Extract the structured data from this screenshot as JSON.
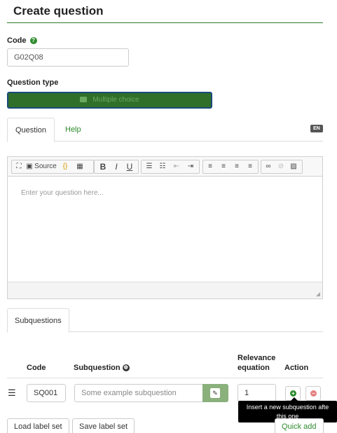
{
  "page": {
    "title": "Create question"
  },
  "code": {
    "label": "Code",
    "value": "G02Q08"
  },
  "question_type": {
    "label": "Question type",
    "selected": "Multiple choice",
    "icon": "list-icon"
  },
  "tabs": {
    "question": "Question",
    "help": "Help",
    "language": "EN"
  },
  "editor": {
    "toolbar": {
      "maximize": "⛶",
      "source": "Source",
      "bold": "B",
      "italic": "I",
      "underline": "U"
    },
    "placeholder": "Enter your question here..."
  },
  "subquestions": {
    "tab": "Subquestions",
    "headers": {
      "code": "Code",
      "subquestion": "Subquestion",
      "relevance_line1": "Relevance",
      "relevance_line2": "equation",
      "action": "Action"
    },
    "rows": [
      {
        "code": "SQ001",
        "text_placeholder": "Some example subquestion",
        "relevance": "1"
      }
    ],
    "tooltip_line1": "Insert a new subquestion afte",
    "tooltip_line2": "this one"
  },
  "buttons": {
    "load_label_set": "Load label set",
    "save_label_set": "Save label set",
    "quick_add": "Quick add"
  },
  "colors": {
    "accent": "#2e8b2e",
    "type_button": "#2f6f2a",
    "add": "#2e8b2e",
    "remove": "#e58080"
  }
}
